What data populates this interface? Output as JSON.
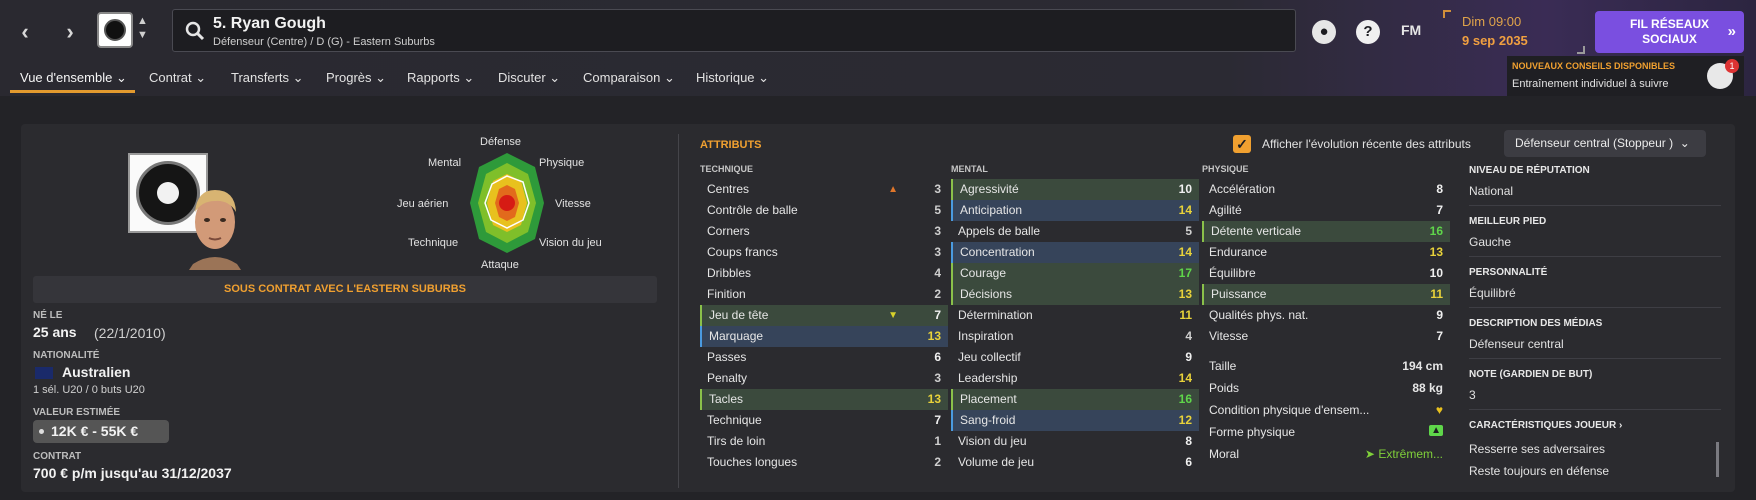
{
  "header": {
    "player_title": "5. Ryan Gough",
    "player_subtitle": "Défenseur (Centre) / D (G) - Eastern Suburbs",
    "fm_label": "FM",
    "date_line1": "Dim 09:00",
    "date_line2": "9 sep 2035",
    "social_button_line1": "FIL RÉSEAUX",
    "social_button_line2": "SOCIAUX",
    "help_glyph": "?",
    "icons": [
      "back-arrow",
      "forward-arrow",
      "search-icon",
      "globe-icon",
      "help-icon",
      "chevron-right-icon"
    ]
  },
  "menu": {
    "items": [
      "Vue d'ensemble",
      "Contrat",
      "Transferts",
      "Progrès",
      "Rapports",
      "Discuter",
      "Comparaison",
      "Historique"
    ]
  },
  "advice": {
    "title": "NOUVEAUX CONSEILS DISPONIBLES",
    "text": "Entraînement individuel à suivre",
    "count": "1"
  },
  "profile": {
    "contract_banner": "SOUS CONTRAT AVEC L'EASTERN SUBURBS",
    "born_label": "NÉ LE",
    "age": "25 ans",
    "birthdate": "(22/1/2010)",
    "nationality_label": "NATIONALITÉ",
    "nationality": "Australien",
    "caps": "1 sél. U20 / 0 buts U20",
    "value_label": "VALEUR ESTIMÉE",
    "value": "12K € - 55K €",
    "contract_label": "CONTRAT",
    "contract": "700 € p/m jusqu'au 31/12/2037"
  },
  "radar": {
    "labels": [
      "Défense",
      "Physique",
      "Vitesse",
      "Vision du jeu",
      "Attaque",
      "Technique",
      "Jeu aérien",
      "Mental"
    ]
  },
  "attributes": {
    "title": "ATTRIBUTS",
    "show_evolution_label": "Afficher l'évolution récente des attributs",
    "role": "Défenseur central (Stoppeur )",
    "technique_header": "TECHNIQUE",
    "mental_header": "MENTAL",
    "physique_header": "PHYSIQUE",
    "technique": [
      {
        "name": "Centres",
        "value": "3"
      },
      {
        "name": "Contrôle de balle",
        "value": "5"
      },
      {
        "name": "Corners",
        "value": "3"
      },
      {
        "name": "Coups francs",
        "value": "3"
      },
      {
        "name": "Dribbles",
        "value": "4"
      },
      {
        "name": "Finition",
        "value": "2"
      },
      {
        "name": "Jeu de tête",
        "value": "7"
      },
      {
        "name": "Marquage",
        "value": "13"
      },
      {
        "name": "Passes",
        "value": "6"
      },
      {
        "name": "Penalty",
        "value": "3"
      },
      {
        "name": "Tacles",
        "value": "13"
      },
      {
        "name": "Technique",
        "value": "7"
      },
      {
        "name": "Tirs de loin",
        "value": "1"
      },
      {
        "name": "Touches longues",
        "value": "2"
      }
    ],
    "mental": [
      {
        "name": "Agressivité",
        "value": "10"
      },
      {
        "name": "Anticipation",
        "value": "14"
      },
      {
        "name": "Appels de balle",
        "value": "5"
      },
      {
        "name": "Concentration",
        "value": "14"
      },
      {
        "name": "Courage",
        "value": "17"
      },
      {
        "name": "Décisions",
        "value": "13"
      },
      {
        "name": "Détermination",
        "value": "11"
      },
      {
        "name": "Inspiration",
        "value": "4"
      },
      {
        "name": "Jeu collectif",
        "value": "9"
      },
      {
        "name": "Leadership",
        "value": "14"
      },
      {
        "name": "Placement",
        "value": "16"
      },
      {
        "name": "Sang-froid",
        "value": "12"
      },
      {
        "name": "Vision du jeu",
        "value": "8"
      },
      {
        "name": "Volume de jeu",
        "value": "6"
      }
    ],
    "physique": [
      {
        "name": "Accélération",
        "value": "8"
      },
      {
        "name": "Agilité",
        "value": "7"
      },
      {
        "name": "Détente verticale",
        "value": "16"
      },
      {
        "name": "Endurance",
        "value": "13"
      },
      {
        "name": "Équilibre",
        "value": "10"
      },
      {
        "name": "Puissance",
        "value": "11"
      },
      {
        "name": "Qualités phys. nat.",
        "value": "9"
      },
      {
        "name": "Vitesse",
        "value": "7"
      }
    ],
    "height_label": "Taille",
    "height": "194 cm",
    "weight_label": "Poids",
    "weight": "88 kg",
    "condition_label": "Condition physique d'ensem...",
    "form_label": "Forme physique",
    "morale_label": "Moral",
    "morale": "Extrêmem..."
  },
  "side": {
    "reputation_label": "NIVEAU DE RÉPUTATION",
    "reputation": "National",
    "foot_label": "MEILLEUR PIED",
    "foot": "Gauche",
    "personality_label": "PERSONNALITÉ",
    "personality": "Équilibré",
    "media_label": "DESCRIPTION DES MÉDIAS",
    "media": "Défenseur central",
    "gk_label": "NOTE (GARDIEN DE BUT)",
    "gk": "3",
    "traits_label": "CARACTÉRISTIQUES JOUEUR",
    "traits": [
      "Resserre ses adversaires",
      "Reste toujours en défense"
    ]
  },
  "colors": {
    "accent": "#f0a030",
    "purple": "#7a4fe0",
    "value_high": "#5fd64a",
    "value_mid": "#e8d23a"
  }
}
